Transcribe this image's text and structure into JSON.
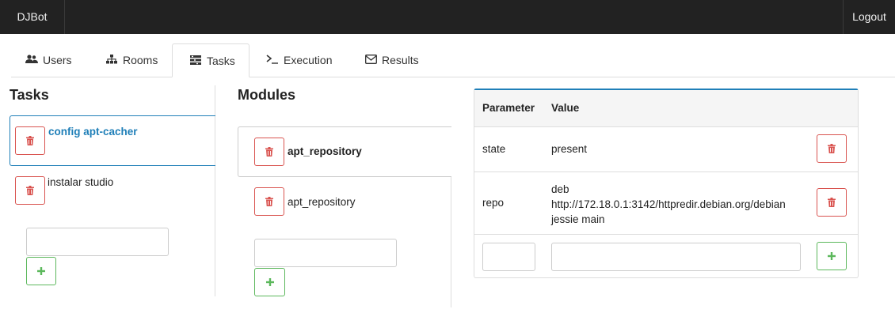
{
  "navbar": {
    "brand": "DJBot",
    "logout": "Logout"
  },
  "tabs": [
    {
      "label": "Users",
      "icon": "users-icon",
      "glyph": "👥"
    },
    {
      "label": "Rooms",
      "icon": "sitemap-icon",
      "glyph": "☷"
    },
    {
      "label": "Tasks",
      "icon": "tasks-icon",
      "glyph": "☰"
    },
    {
      "label": "Execution",
      "icon": "terminal-icon",
      "glyph": ">_"
    },
    {
      "label": "Results",
      "icon": "envelope-icon",
      "glyph": "✉"
    }
  ],
  "active_tab": "Tasks",
  "tasks": {
    "heading": "Tasks",
    "items": [
      {
        "label": "config apt-cacher",
        "active": true
      },
      {
        "label": "instalar studio",
        "active": false
      }
    ],
    "new_input": {
      "value": "",
      "placeholder": ""
    }
  },
  "modules": {
    "heading": "Modules",
    "items": [
      {
        "label": "apt_repository",
        "selected": true
      },
      {
        "label": "apt_repository",
        "selected": false
      }
    ],
    "new_input": {
      "value": "",
      "placeholder": ""
    }
  },
  "parameters": {
    "headers": {
      "parameter": "Parameter",
      "value": "Value"
    },
    "rows": [
      {
        "parameter": "state",
        "value": "present"
      },
      {
        "parameter": "repo",
        "value_lines": [
          "deb",
          "http://172.18.0.1:3142/httpredir.debian.org/debian",
          "jessie main"
        ]
      }
    ],
    "new_row": {
      "parameter": "",
      "value": ""
    }
  },
  "colors": {
    "accent": "#1f7fb8",
    "danger": "#d9534f",
    "success": "#5cb85c",
    "navbar": "#222222"
  }
}
